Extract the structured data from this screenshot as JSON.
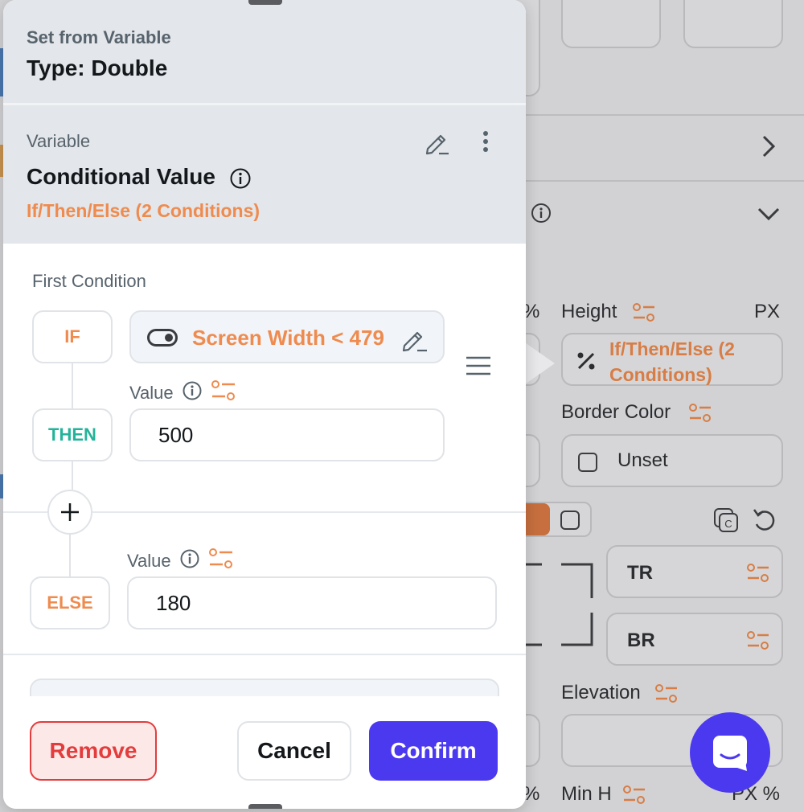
{
  "dialog": {
    "header": {
      "subtitle": "Set from Variable",
      "title": "Type: Double"
    },
    "variable": {
      "label": "Variable",
      "name": "Conditional Value",
      "description": "If/Then/Else (2 Conditions)"
    },
    "first_condition": {
      "title": "First Condition",
      "if_label": "IF",
      "condition_text": "Screen Width  <  479",
      "then_label": "THEN",
      "then_value_label": "Value",
      "then_value": "500",
      "else_label": "ELSE",
      "else_value_label": "Value",
      "else_value": "180"
    },
    "buttons": {
      "remove": "Remove",
      "cancel": "Cancel",
      "confirm": "Confirm"
    }
  },
  "background_panel": {
    "height_label": "Height",
    "height_unit": "PX",
    "percent_symbol": "%",
    "height_value": "If/Then/Else (2 Conditions)",
    "border_color_label": "Border Color",
    "border_color_value": "Unset",
    "radius_tr": "TR",
    "radius_br": "BR",
    "elevation_label": "Elevation",
    "min_h_label": "Min H",
    "min_h_unit": "PX %",
    "bottom_percent": "%"
  },
  "colors": {
    "accent": "#4b39ef",
    "orange": "#ef8b4e",
    "teal": "#24b39a",
    "error": "#e43c3c"
  },
  "icons": [
    "edit-icon",
    "more-vert-icon",
    "info-icon",
    "toggle-icon",
    "reorder-icon",
    "plus-icon",
    "tune-icon",
    "chevron-right-icon",
    "chevron-down-icon",
    "copy-icon",
    "undo-icon",
    "chat-icon",
    "checkbox-icon"
  ]
}
